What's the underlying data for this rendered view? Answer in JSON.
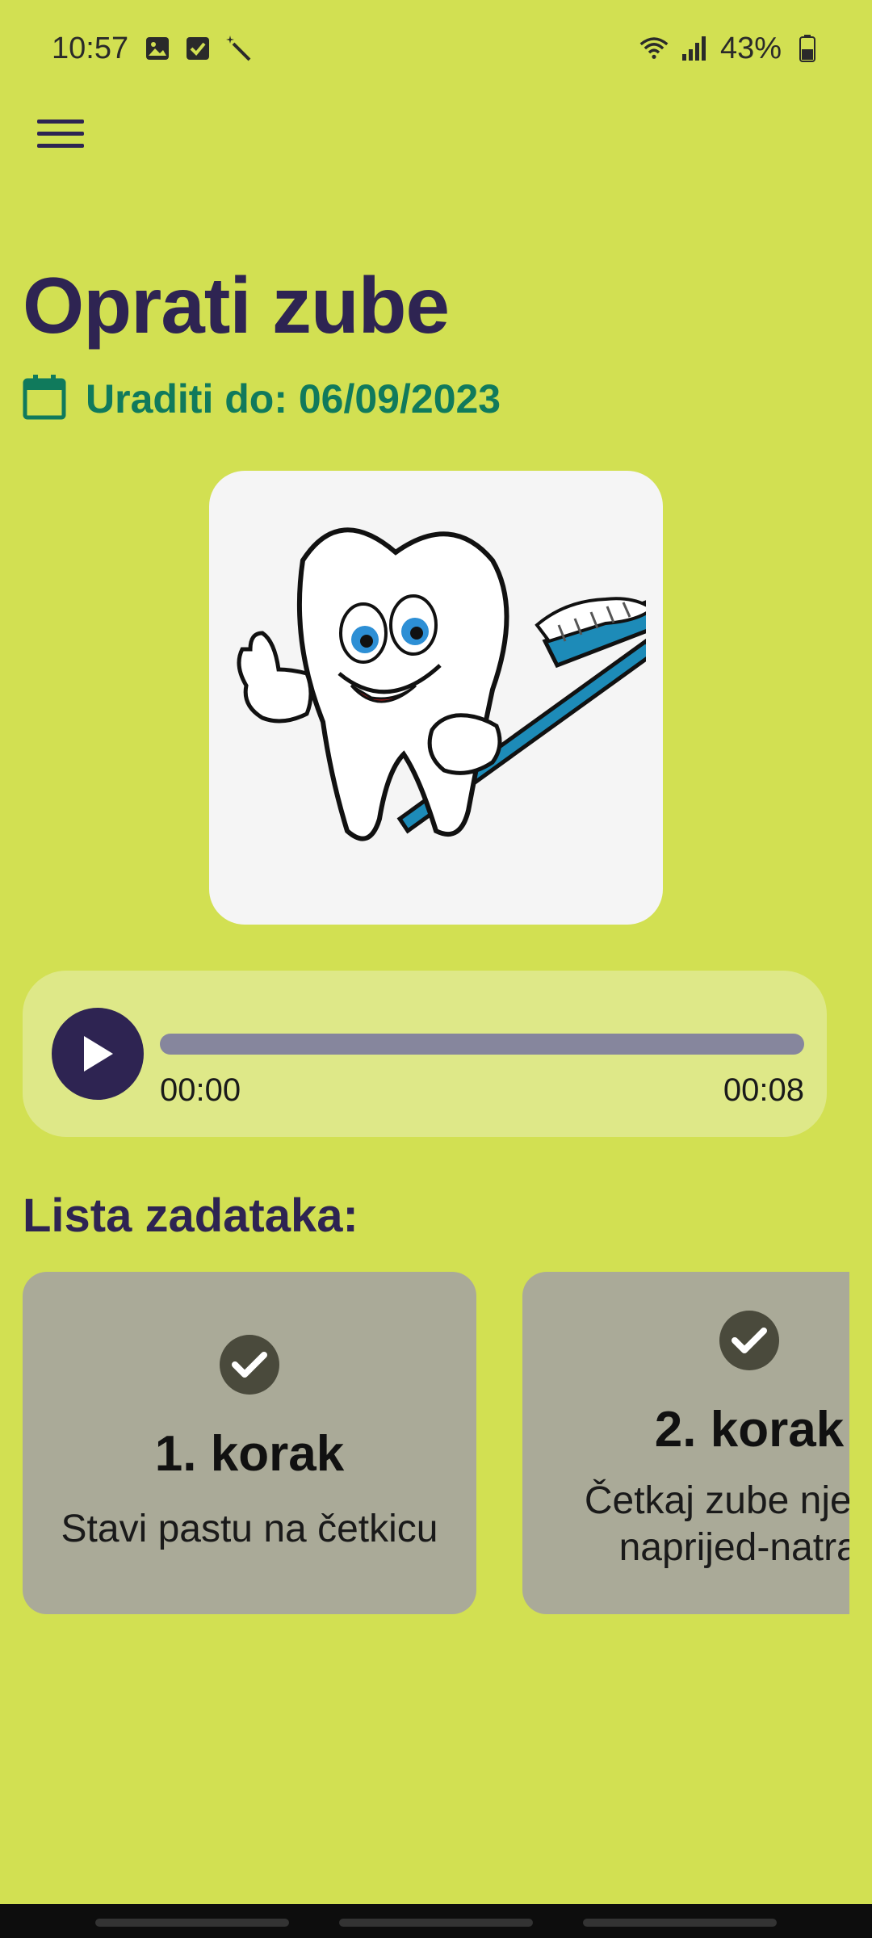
{
  "status_bar": {
    "time": "10:57",
    "battery": "43%",
    "icons": [
      "image-icon",
      "checkbox-icon",
      "magic-wand-icon",
      "wifi-icon",
      "signal-icon",
      "battery-icon"
    ]
  },
  "header": {
    "menu_icon": "hamburger-menu-icon"
  },
  "task": {
    "title": "Oprati zube",
    "due_label": "Uraditi do: 06/09/2023",
    "image_alt": "Cartoon tooth holding a toothbrush"
  },
  "audio": {
    "current_time": "00:00",
    "total_time": "00:08",
    "progress": 0
  },
  "steps_section": {
    "title": "Lista zadataka:",
    "steps": [
      {
        "step": "1. korak",
        "description": "Stavi pastu na četkicu",
        "completed": true
      },
      {
        "step": "2. korak",
        "description": "Četkaj zube nježno naprijed-natrag",
        "completed": true
      }
    ]
  },
  "colors": {
    "background": "#d2e052",
    "primary": "#2e2452",
    "accent": "#107a5c",
    "card": "#aaaa98",
    "player_bg": "#dee888"
  }
}
